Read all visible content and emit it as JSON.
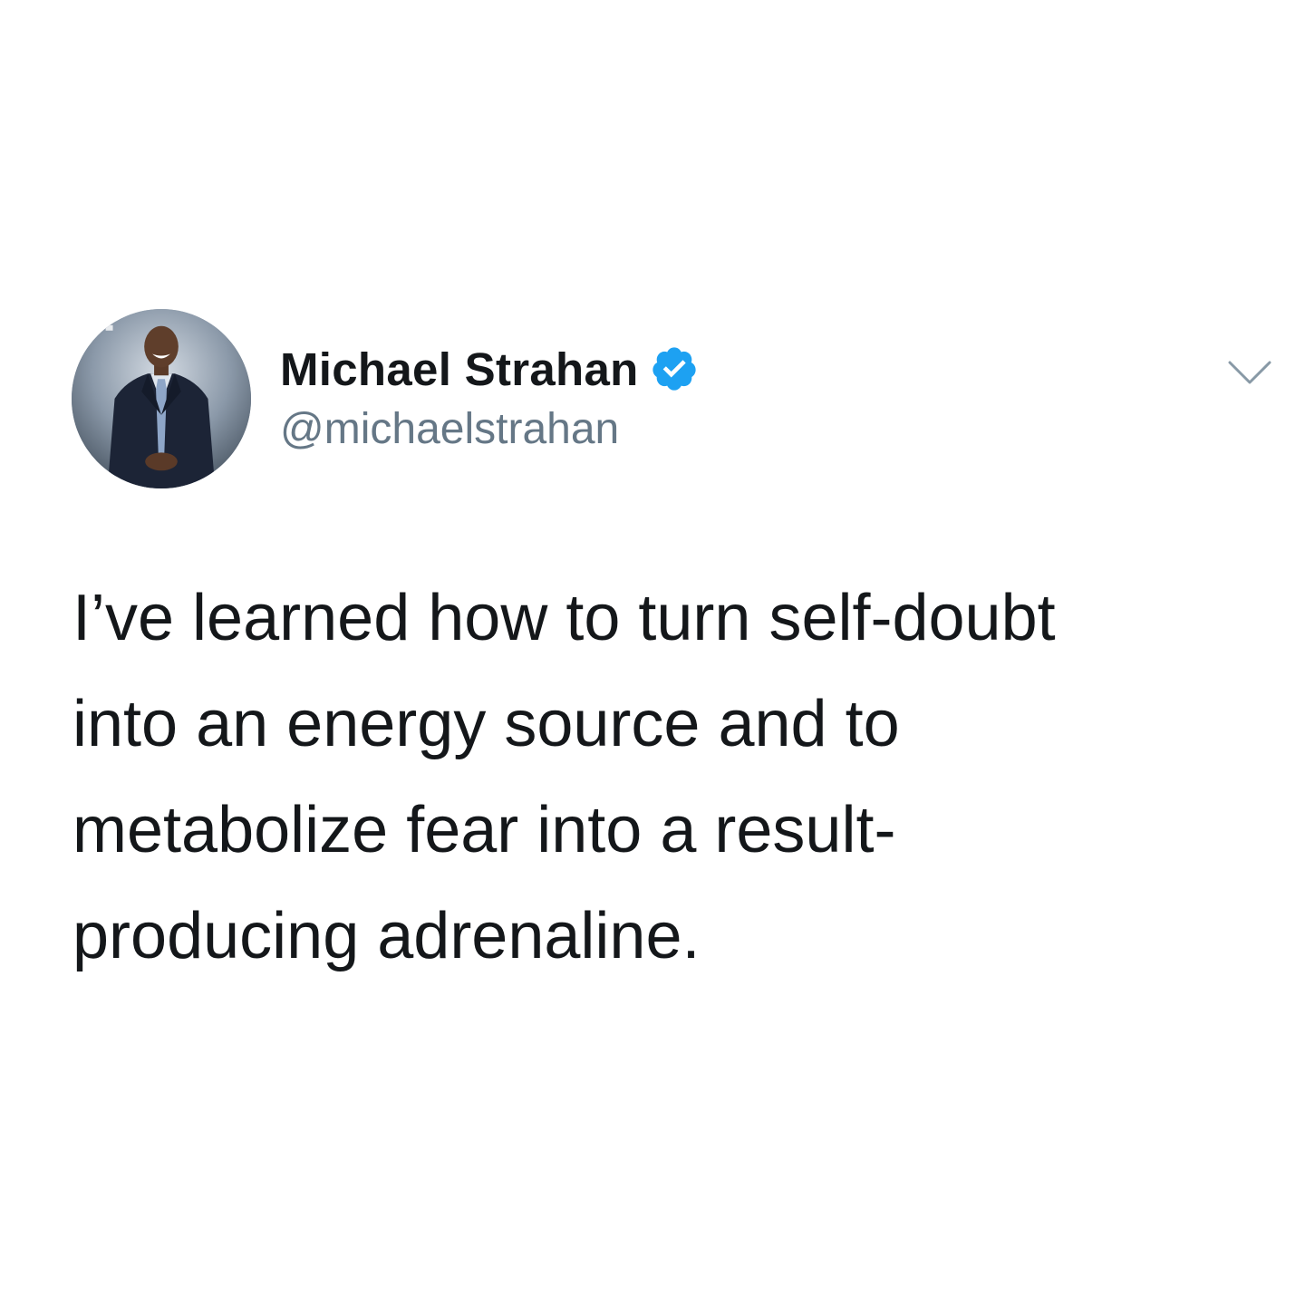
{
  "tweet": {
    "author": {
      "display_name": "Michael Strahan",
      "handle": "@michaelstrahan",
      "verified": true,
      "verified_badge_color": "#1da1f2",
      "avatar_icon": "profile-photo"
    },
    "menu_icon": "chevron-down-icon",
    "text_lines": [
      "I’ve learned how to turn self-doubt",
      "into an energy source and to",
      "metabolize fear into a result-",
      "producing adrenaline."
    ]
  },
  "colors": {
    "text_primary": "#14171a",
    "text_secondary": "#657786",
    "chevron": "#8899a6",
    "background": "#ffffff"
  }
}
